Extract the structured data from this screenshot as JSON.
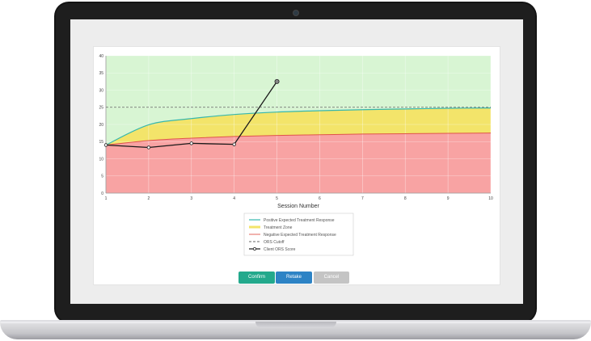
{
  "buttons": {
    "confirm": "Confirm",
    "retake": "Retake",
    "cancel": "Cancel"
  },
  "legend": {
    "positive": "Positive Expected Treatment Response",
    "zone": "Treatment Zone",
    "negative": "Negative Expected Treatment Response",
    "cutoff": "ORS Cutoff",
    "client": "Client ORS Score"
  },
  "colors": {
    "positive_line": "#37b7ad",
    "zone_fill": "#f3e46a",
    "negative_line": "#e0534b",
    "below_fill": "#f8a3a3",
    "above_fill": "#d8f5d3",
    "cutoff_line": "#666666",
    "client_line": "#1a1a1a",
    "confirm": "#23a98c",
    "retake": "#2d83c5",
    "cancel": "#c4c4c4"
  },
  "chart_data": {
    "type": "line",
    "xlabel": "Session Number",
    "ylabel": "",
    "x": [
      1,
      2,
      3,
      4,
      5,
      6,
      7,
      8,
      9,
      10
    ],
    "xlim": [
      1,
      10
    ],
    "ylim": [
      0,
      40
    ],
    "yticks": [
      0,
      5,
      10,
      15,
      20,
      25,
      30,
      35,
      40
    ],
    "cutoff": 25,
    "series": [
      {
        "name": "Positive Expected Treatment Response",
        "values": [
          14,
          19.9,
          21.7,
          22.9,
          23.6,
          24.0,
          24.3,
          24.5,
          24.7,
          24.8
        ]
      },
      {
        "name": "Negative Expected Treatment Response",
        "values": [
          14,
          15.3,
          16.0,
          16.5,
          16.8,
          17.0,
          17.2,
          17.3,
          17.4,
          17.5
        ]
      },
      {
        "name": "Client ORS Score",
        "x": [
          1,
          2,
          3,
          4,
          5
        ],
        "values": [
          14,
          13.3,
          14.5,
          14.2,
          32.5
        ]
      }
    ],
    "grid": true
  }
}
